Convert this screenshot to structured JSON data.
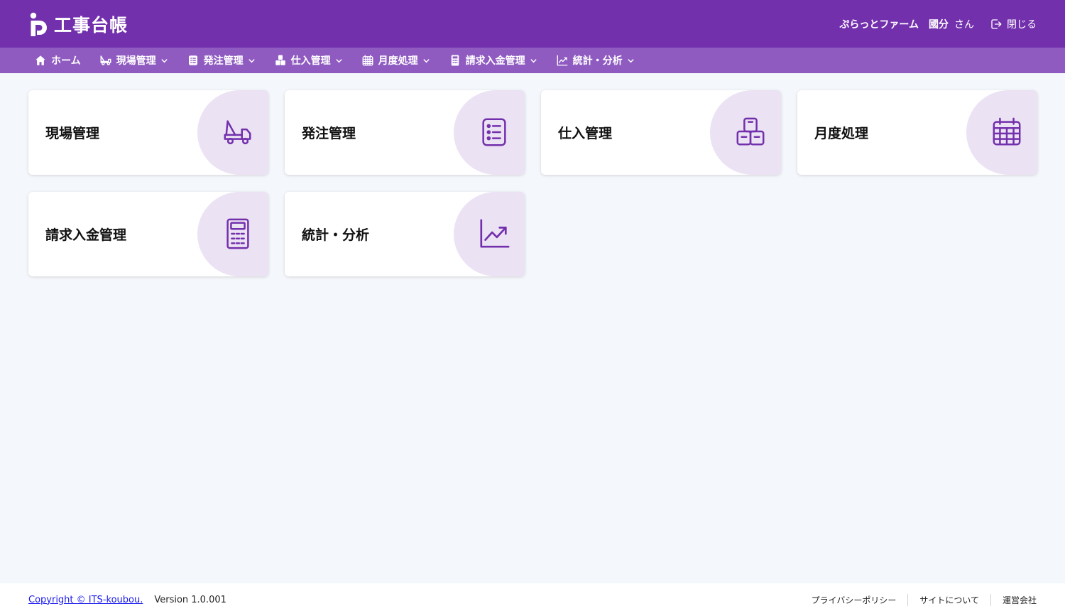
{
  "header": {
    "title": "工事台帳",
    "company": "ぷらっとファーム",
    "user": "國分",
    "honorific": "さん",
    "close_label": "閉じる"
  },
  "nav": {
    "items": [
      {
        "label": "ホーム",
        "icon": "home-icon"
      },
      {
        "label": "現場管理",
        "icon": "truck-icon"
      },
      {
        "label": "発注管理",
        "icon": "order-list-icon"
      },
      {
        "label": "仕入管理",
        "icon": "boxes-icon"
      },
      {
        "label": "月度処理",
        "icon": "calendar-icon"
      },
      {
        "label": "請求入金管理",
        "icon": "calculator-icon"
      },
      {
        "label": "統計・分析",
        "icon": "chart-line-icon"
      }
    ]
  },
  "cards": [
    {
      "label": "現場管理",
      "icon": "truck-icon"
    },
    {
      "label": "発注管理",
      "icon": "order-list-icon"
    },
    {
      "label": "仕入管理",
      "icon": "boxes-icon"
    },
    {
      "label": "月度処理",
      "icon": "calendar-icon"
    },
    {
      "label": "請求入金管理",
      "icon": "calculator-icon"
    },
    {
      "label": "統計・分析",
      "icon": "chart-line-icon"
    }
  ],
  "footer": {
    "copyright": "Copyright © ITS-koubou.",
    "version": "Version 1.0.001",
    "links": [
      "プライバシーポリシー",
      "サイトについて",
      "運営会社"
    ]
  },
  "colors": {
    "header_bg": "#7330ad",
    "nav_bg": "#8f5bc1",
    "accent": "#7330ad",
    "card_icon_bg": "#ebe2f3",
    "page_bg": "#f4f7fb"
  }
}
